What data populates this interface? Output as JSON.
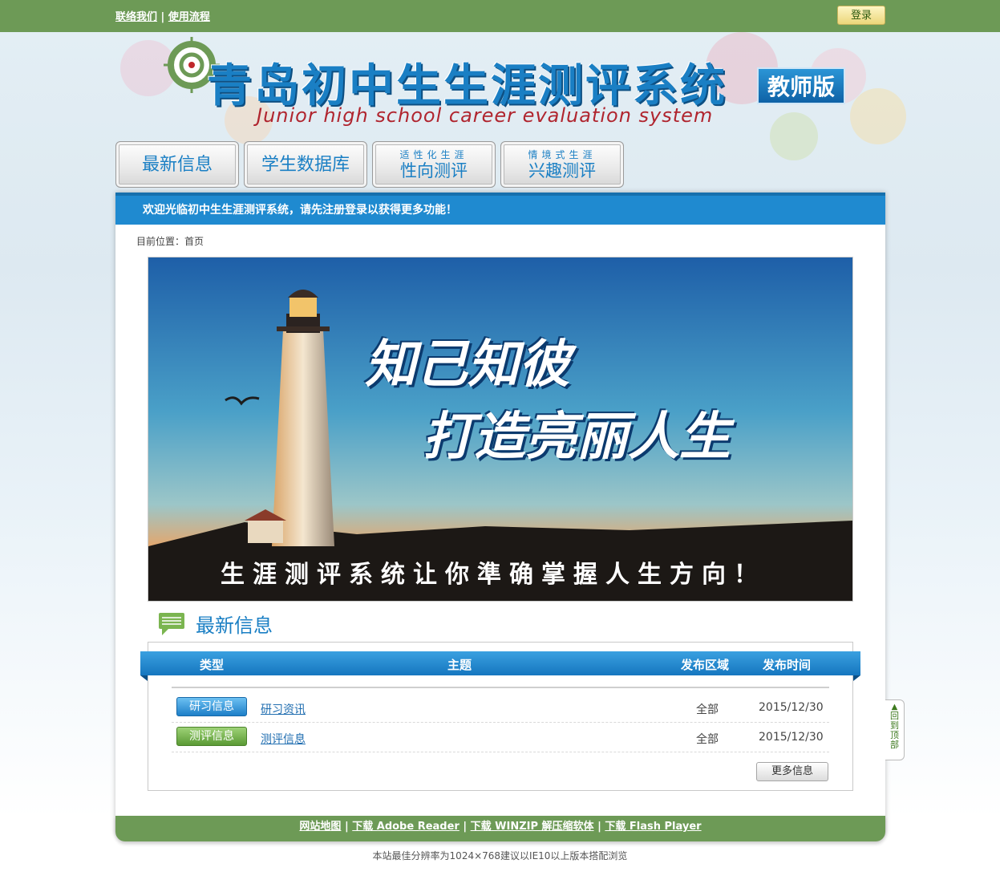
{
  "topbar": {
    "contact_label": "联络我们",
    "separator": "|",
    "process_label": "使用流程",
    "login_label": "登录"
  },
  "logo": {
    "title": "青岛初中生生涯测评系统",
    "badge": "教师版",
    "subtitle": "Junior high school career evaluation system"
  },
  "nav": {
    "items": [
      {
        "label": "最新信息"
      },
      {
        "label": "学生数据库"
      },
      {
        "small": "适性化生涯",
        "label": "性向测评"
      },
      {
        "small": "情境式生涯",
        "label": "兴趣测评"
      }
    ]
  },
  "welcome": "欢迎光临初中生生涯测评系统，请先注册登录以获得更多功能！",
  "breadcrumb": "目前位置：首页",
  "banner": {
    "line1": "知己知彼",
    "line2": "打造亮丽人生",
    "tagline": "生涯测评系统让你準确掌握人生方向！"
  },
  "news": {
    "title": "最新信息",
    "columns": [
      "类型",
      "主题",
      "发布区域",
      "发布时间"
    ],
    "rows": [
      {
        "type": "研习信息",
        "subject": "研习资讯",
        "area": "全部",
        "date": "2015/12/30"
      },
      {
        "type": "测评信息",
        "subject": "测评信息",
        "area": "全部",
        "date": "2015/12/30"
      }
    ],
    "more_label": "更多信息"
  },
  "back_to_top": "回到顶部",
  "footer": {
    "sitemap": "网站地图",
    "adobe": "下载 Adobe Reader",
    "winzip": "下载 WINZIP 解压缩软体",
    "flash": "下载 Flash Player",
    "sep": "|",
    "note": "本站最佳分辨率为1024×768建议以IE10以上版本搭配浏览"
  },
  "colors": {
    "topbar": "#6d9a56",
    "accent_blue": "#1f8ad0",
    "title_blue": "#1a7fc4",
    "subtitle_red": "#b0252f"
  }
}
